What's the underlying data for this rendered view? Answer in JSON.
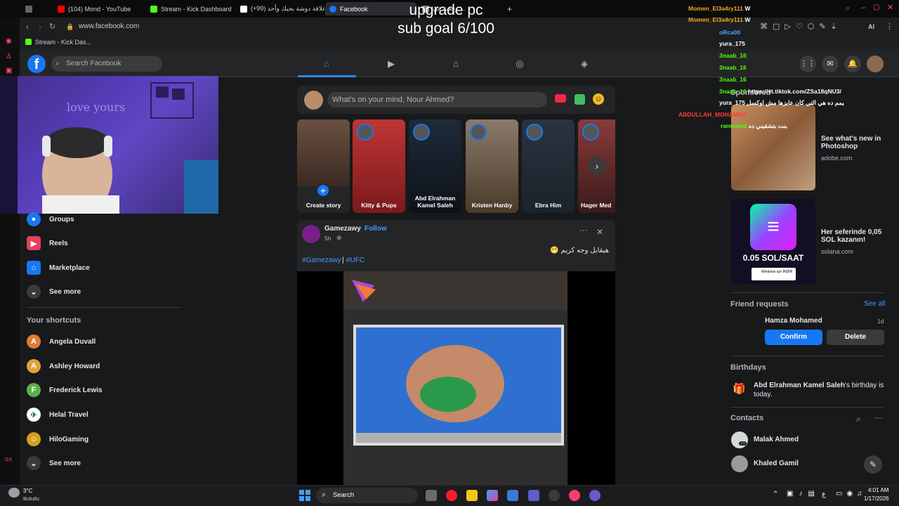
{
  "browser": {
    "tabs": [
      {
        "label": "(104) Mond - YouTube",
        "color": "#ff0000"
      },
      {
        "label": "Stream - Kick Dashboard",
        "color": "#53fc18"
      },
      {
        "label": "(+99) علاقة دوشة بحبك وأحد...",
        "color": "#ffffff"
      },
      {
        "label": "Facebook",
        "color": "#1877f2"
      },
      {
        "label": "وقعت في ...",
        "color": "#888888"
      }
    ],
    "new_tab_label": "+",
    "url": "www.facebook.com",
    "bookmark": "Stream - Kick Das..."
  },
  "overlay": {
    "title_line1": "upgrade pc",
    "title_line2": "sub goal 6/100"
  },
  "facebook": {
    "logo": "f",
    "search_placeholder": "Search Facebook",
    "menu": [
      {
        "label": "Groups",
        "color": "#1877f2",
        "icon": "groups-icon"
      },
      {
        "label": "Reels",
        "color": "#e4405f",
        "icon": "reels-icon"
      },
      {
        "label": "Marketplace",
        "color": "#1877f2",
        "icon": "marketplace-icon"
      },
      {
        "label": "See more",
        "color": "#3a3b3c",
        "icon": "chevron-down-icon"
      }
    ],
    "shortcuts_title": "Your shortcuts",
    "shortcuts": [
      {
        "label": "Angela Duvall",
        "letter": "A",
        "color": "#e07b39"
      },
      {
        "label": "Ashley Howard",
        "letter": "A",
        "color": "#e0a339"
      },
      {
        "label": "Frederick Lewis",
        "letter": "F",
        "color": "#5bb04a"
      },
      {
        "label": "Helal Travel",
        "letter": "",
        "color": "#ffffff"
      },
      {
        "label": "HiloGaming",
        "letter": "",
        "color": "#d4a017"
      },
      {
        "label": "See more",
        "letter": "",
        "color": "#3a3b3c"
      }
    ],
    "composer_placeholder": "What's on your mind, Nour Ahmed?",
    "stories": [
      {
        "label": "Create story",
        "bg": "#3b3b3b"
      },
      {
        "label": "Kitty & Pups",
        "bg": "#b02a2a"
      },
      {
        "label": "Abd Elrahman Kamel Saleh",
        "bg": "#1e2a3a"
      },
      {
        "label": "Kristen Hanby",
        "bg": "#6b5a4a"
      },
      {
        "label": "Ebra Him",
        "bg": "#2a3440"
      },
      {
        "label": "Hager Med",
        "bg": "#7a2a2a"
      }
    ],
    "post": {
      "author": "Gamezawy",
      "follow": "Follow",
      "time": "5h",
      "caption": "هيقابل وجه كريم 😁",
      "hashtag1": "#Gamezawy",
      "separator": "|",
      "hashtag2": "#UFC",
      "more": "···",
      "close": "✕"
    },
    "sponsored_title": "Sponsored",
    "ads": [
      {
        "title": "See what's new in Photoshop",
        "site": "adobe.com"
      },
      {
        "title": "Her seferinde 0,05 SOL kazanın!",
        "site": "solana.com",
        "image_text": "0.05 SOL/SAAT",
        "badge": "Windows için İNDİR"
      }
    ],
    "friend_requests_title": "Friend requests",
    "see_all": "See all",
    "request": {
      "name": "Hamza Mohamed",
      "age": "1d",
      "confirm": "Confirm",
      "delete": "Delete"
    },
    "birthdays_title": "Birthdays",
    "birthday_name": "Abd Elrahman Kamel Saleh",
    "birthday_text": "'s birthday is today.",
    "contacts_title": "Contacts",
    "contacts": [
      {
        "name": "Malak Ahmed",
        "badge": "1h"
      },
      {
        "name": "Khaled Gamil",
        "badge": ""
      }
    ]
  },
  "chat": [
    {
      "user": "Momen_El3a4ry111",
      "msg": "W",
      "color": "#f5a623"
    },
    {
      "user": "Momen_El3a4ry111",
      "msg": "W",
      "color": "#f5a623"
    },
    {
      "user": "oRca00",
      "msg": "",
      "color": "#4aa3ff"
    },
    {
      "user": "yura_175",
      "msg": "",
      "color": "#ffffff"
    },
    {
      "user": "3naab_16",
      "msg": "",
      "color": "#53fc18"
    },
    {
      "user": "3naab_16",
      "msg": "",
      "color": "#53fc18"
    },
    {
      "user": "3naab_16",
      "msg": "",
      "color": "#53fc18"
    },
    {
      "user": "3naab_16",
      "msg": "https://vt.tiktok.com/ZSa18qNU3/",
      "color": "#53fc18"
    },
    {
      "user": "yura_175",
      "msg": "يمم ده هي التي كان عايزها مش اوكسل",
      "color": "#ffffff"
    },
    {
      "user": "ABDULLAH_MOHAMED",
      "msg": "",
      "color": "#ff3b3b"
    },
    {
      "user": "ranwahid",
      "msg": "بنت بتشقيني ده",
      "color": "#53fc18"
    }
  ],
  "taskbar": {
    "weather_temp": "3°C",
    "weather_desc": "Bulutlu",
    "search": "Search",
    "time": "4:01 AM",
    "date": "1/17/2026",
    "lang": "ع"
  }
}
